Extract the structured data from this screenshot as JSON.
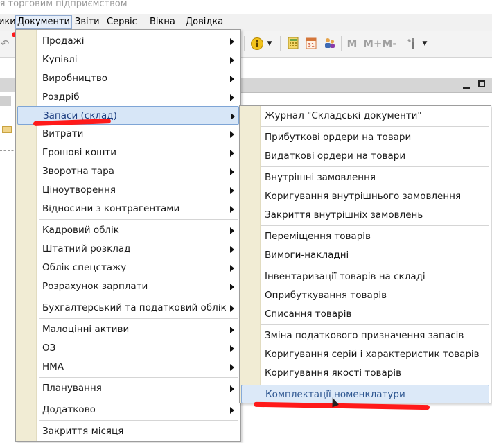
{
  "window": {
    "title": "ія торговим підприємством"
  },
  "menubar": [
    {
      "label": "ики"
    },
    {
      "label": "Документи"
    },
    {
      "label": "Звіти"
    },
    {
      "label": "Сервіс"
    },
    {
      "label": "Вікна"
    },
    {
      "label": "Довідка"
    }
  ],
  "toolbar": {
    "m_label": "M",
    "mplus_label": "M+",
    "mminus_label": "M-",
    "icons": [
      "undo-icon",
      "info-icon",
      "calculator-icon",
      "calendar-icon",
      "users-icon",
      "tools-icon"
    ]
  },
  "documents_menu": {
    "items": [
      {
        "label": "Продажі",
        "submenu": true
      },
      {
        "label": "Купівлі",
        "submenu": true
      },
      {
        "label": "Виробництво",
        "submenu": true
      },
      {
        "label": "Роздріб",
        "submenu": true
      },
      {
        "label": "Запаси (склад)",
        "submenu": true,
        "highlighted": true
      },
      {
        "label": "Витрати",
        "submenu": true
      },
      {
        "label": "Грошові кошти",
        "submenu": true
      },
      {
        "label": "Зворотна тара",
        "submenu": true
      },
      {
        "label": "Ціноутворення",
        "submenu": true
      },
      {
        "label": "Відносини з контрагентами",
        "submenu": true
      },
      {
        "label": "Кадровий облік",
        "submenu": true
      },
      {
        "label": "Штатний розклад",
        "submenu": true
      },
      {
        "label": "Облік спецстажу",
        "submenu": true
      },
      {
        "label": "Розрахунок зарплати",
        "submenu": true
      },
      {
        "label": "Бухгалтерський та податковий облік",
        "submenu": true
      },
      {
        "label": "Малоцінні активи",
        "submenu": true
      },
      {
        "label": "ОЗ",
        "submenu": true
      },
      {
        "label": "НМА",
        "submenu": true
      },
      {
        "label": "Планування",
        "submenu": true
      },
      {
        "label": "Додатково",
        "submenu": true
      },
      {
        "label": "Закриття місяця",
        "submenu": false
      }
    ]
  },
  "stock_submenu": {
    "items": [
      {
        "label": "Журнал \"Складські документи\""
      },
      {
        "label": "Прибуткові ордери на товари"
      },
      {
        "label": "Видаткові ордери на товари"
      },
      {
        "label": "Внутрішні замовлення"
      },
      {
        "label": "Коригування внутрішнього замовлення"
      },
      {
        "label": "Закриття внутрішніх замовлень"
      },
      {
        "label": "Переміщення товарів"
      },
      {
        "label": "Вимоги-накладні"
      },
      {
        "label": "Інвентаризації товарів на складі"
      },
      {
        "label": "Оприбуткування товарів"
      },
      {
        "label": "Списання товарів"
      },
      {
        "label": "Зміна податкового призначення запасів"
      },
      {
        "label": "Коригування серій і характеристик товарів"
      },
      {
        "label": "Коригування якості товарів"
      },
      {
        "label": "Комплектації номенклатури",
        "highlighted": true
      }
    ]
  },
  "colors": {
    "highlight_bg": "#d7e6f7",
    "highlight_border": "#7ea5d6",
    "gutter": "#f1ecd4",
    "annotation_red": "#ff1a1a"
  }
}
